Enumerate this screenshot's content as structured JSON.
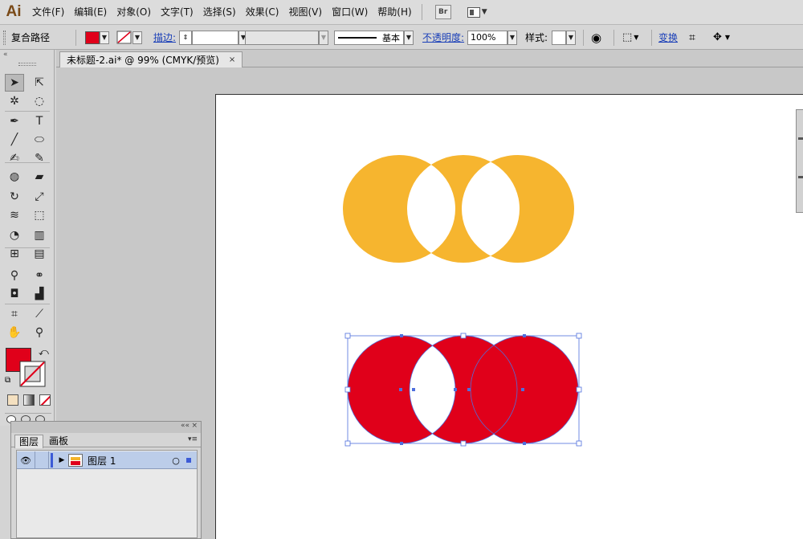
{
  "app": {
    "logo": "Ai",
    "colors": {
      "accent_link": "#1a3fb8",
      "fill_red": "#e0001a",
      "shape_yellow": "#f6b52f",
      "selection_blue": "#4f6fdd"
    }
  },
  "menu": {
    "items": [
      "文件(F)",
      "编辑(E)",
      "对象(O)",
      "文字(T)",
      "选择(S)",
      "效果(C)",
      "视图(V)",
      "窗口(W)",
      "帮助(H)"
    ],
    "bridge_label": "Br"
  },
  "control": {
    "selection_label": "复合路径",
    "fill_color": "#e0001a",
    "stroke_label": "描边:",
    "stroke_style": "基本",
    "opacity_label": "不透明度:",
    "opacity_value": "100%",
    "style_label": "样式:",
    "transform_label": "变换"
  },
  "toolbar": {
    "collapse_icon": "«",
    "fill_color": "#e0001a",
    "tools": [
      {
        "name": "selection-tool-icon",
        "glyph": "➤"
      },
      {
        "name": "direct-selection-tool-icon",
        "glyph": "⇱"
      },
      {
        "name": "magic-wand-tool-icon",
        "glyph": "✲"
      },
      {
        "name": "lasso-tool-icon",
        "glyph": "◌"
      },
      {
        "name": "pen-tool-icon",
        "glyph": "✒"
      },
      {
        "name": "type-tool-icon",
        "glyph": "T"
      },
      {
        "name": "line-tool-icon",
        "glyph": "╱"
      },
      {
        "name": "ellipse-tool-icon",
        "glyph": "⬭"
      },
      {
        "name": "paintbrush-tool-icon",
        "glyph": "✍"
      },
      {
        "name": "pencil-tool-icon",
        "glyph": "✎"
      },
      {
        "name": "blob-brush-tool-icon",
        "glyph": "◍"
      },
      {
        "name": "eraser-tool-icon",
        "glyph": "▰"
      },
      {
        "name": "rotate-tool-icon",
        "glyph": "↻"
      },
      {
        "name": "scale-tool-icon",
        "glyph": "⤢"
      },
      {
        "name": "width-tool-icon",
        "glyph": "≋"
      },
      {
        "name": "free-transform-tool-icon",
        "glyph": "⬚"
      },
      {
        "name": "shape-builder-tool-icon",
        "glyph": "◔"
      },
      {
        "name": "perspective-grid-tool-icon",
        "glyph": "▥"
      },
      {
        "name": "mesh-tool-icon",
        "glyph": "⊞"
      },
      {
        "name": "gradient-tool-icon",
        "glyph": "▤"
      },
      {
        "name": "eyedropper-tool-icon",
        "glyph": "⚲"
      },
      {
        "name": "blend-tool-icon",
        "glyph": "⚭"
      },
      {
        "name": "symbol-sprayer-tool-icon",
        "glyph": "◘"
      },
      {
        "name": "column-graph-tool-icon",
        "glyph": "▟"
      },
      {
        "name": "artboard-tool-icon",
        "glyph": "⌗"
      },
      {
        "name": "slice-tool-icon",
        "glyph": "⟋"
      },
      {
        "name": "hand-tool-icon",
        "glyph": "✋"
      },
      {
        "name": "zoom-tool-icon",
        "glyph": "⚲"
      }
    ]
  },
  "document": {
    "tab_title": "未标题-2.ai* @ 99% (CMYK/预览)",
    "close_icon": "×"
  },
  "layers_panel": {
    "collapse_icon": "««",
    "close_icon": "×",
    "tabs": [
      "图层",
      "画板"
    ],
    "menu_icon": "▾≡",
    "layer_name": "图层 1"
  }
}
